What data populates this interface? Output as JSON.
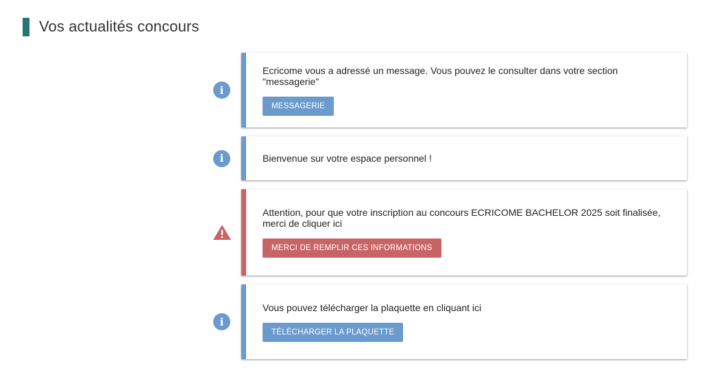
{
  "header": {
    "title": "Vos actualités concours"
  },
  "colors": {
    "info": "#6b9bcd",
    "warning": "#c86466",
    "header_accent": "#267474"
  },
  "news": [
    {
      "type": "info",
      "icon": "info-icon",
      "text": "Ecricome vous a adressé un message. Vous pouvez le consulter dans votre section \"messagerie\"",
      "button": "MESSAGERIE"
    },
    {
      "type": "info",
      "icon": "info-icon",
      "text": "Bienvenue sur votre espace personnel !"
    },
    {
      "type": "warning",
      "icon": "warning-icon",
      "text": "Attention, pour que votre inscription au concours ECRICOME BACHELOR 2025 soit finalisée, merci de cliquer ici",
      "button": "MERCI DE REMPLIR CES INFORMATIONS"
    },
    {
      "type": "info",
      "icon": "info-icon",
      "text": "Vous pouvez télécharger la plaquette en cliquant ici",
      "button": "TÉLÉCHARGER LA PLAQUETTE"
    }
  ]
}
